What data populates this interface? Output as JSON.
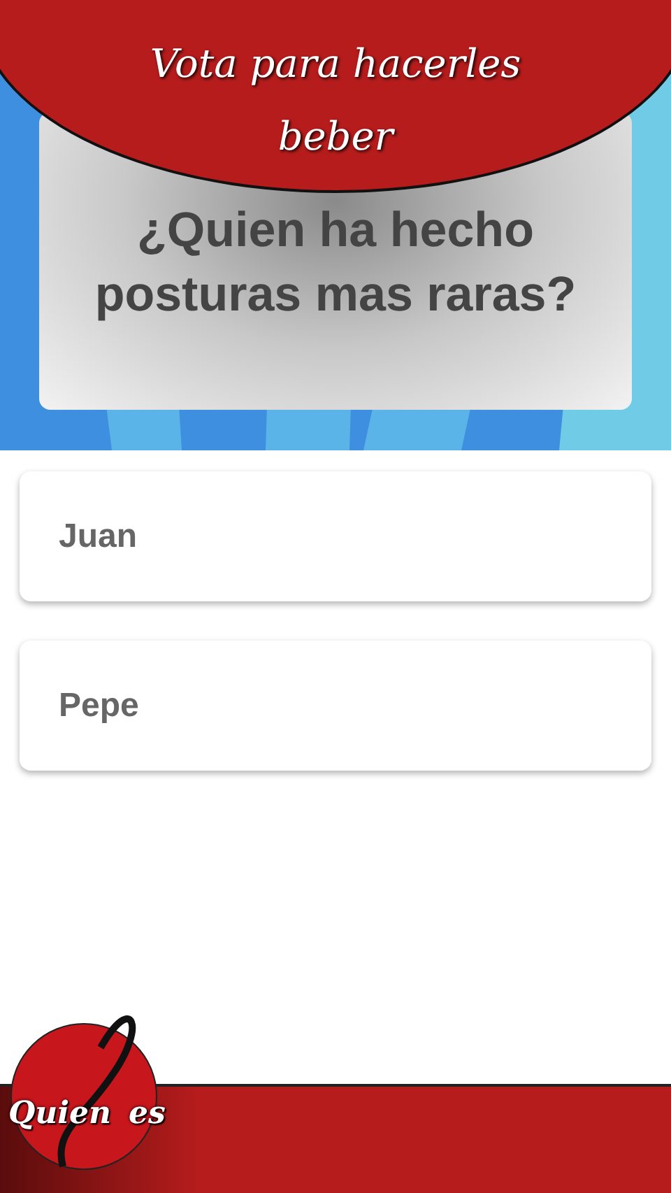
{
  "banner": {
    "title": "Vota para hacerles beber"
  },
  "question": "¿Quien ha hecho posturas mas raras?",
  "options": [
    {
      "label": "Juan"
    },
    {
      "label": "Pepe"
    }
  ],
  "logo": {
    "first_word": "Quien",
    "second_word": "es"
  }
}
